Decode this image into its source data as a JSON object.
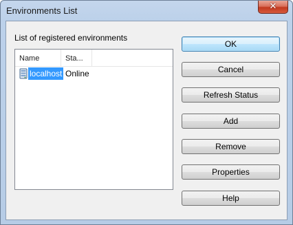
{
  "window": {
    "title": "Environments List",
    "close_glyph": "✕"
  },
  "group_label": "List of registered environments",
  "list": {
    "columns": [
      "Name",
      "Sta..."
    ],
    "rows": [
      {
        "name": "localhost",
        "status": "Online",
        "icon": "server-icon",
        "selected": true
      }
    ]
  },
  "buttons": {
    "ok": "OK",
    "cancel": "Cancel",
    "refresh": "Refresh Status",
    "add": "Add",
    "remove": "Remove",
    "properties": "Properties",
    "help": "Help"
  },
  "colors": {
    "selection": "#3399ff",
    "default_button_border": "#3c7fb1",
    "close_button": "#c2391f"
  }
}
